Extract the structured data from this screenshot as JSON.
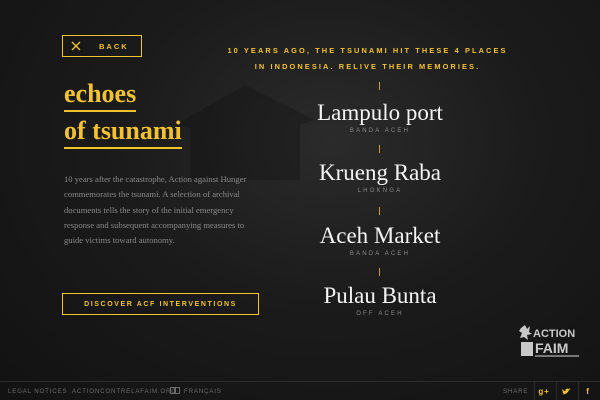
{
  "nav": {
    "back_label": "BACK"
  },
  "title": {
    "line1": "echoes",
    "line2": "of tsunami"
  },
  "description": "10 years after the catastrophe, Action against Hunger commemorates the tsunami. A selection of archival documents tells the story of the initial emergency response and subsequent accompanying measures to guide victims toward autonomy.",
  "discover_label": "DISCOVER ACF INTERVENTIONS",
  "intro": {
    "line1": "10 YEARS AGO, THE TSUNAMI HIT THESE 4 PLACES",
    "line2": "IN INDONESIA. RELIVE THEIR MEMORIES."
  },
  "places": [
    {
      "name": "Lampulo port",
      "sub": "BANDA ACEH"
    },
    {
      "name": "Krueng Raba",
      "sub": "LHOKNGA"
    },
    {
      "name": "Aceh Market",
      "sub": "BANDA ACEH"
    },
    {
      "name": "Pulau Bunta",
      "sub": "OFF ACEH"
    }
  ],
  "logo": {
    "line1": "ACTION",
    "line2": "FAIM"
  },
  "footer": {
    "legal": "LEGAL NOTICES",
    "site": "ACTIONCONTRELAFAIM.ORG",
    "lang": "FRANÇAIS",
    "share": "SHARE"
  },
  "icons": {
    "back": "close-icon",
    "googleplus": "googleplus-icon",
    "twitter": "twitter-icon",
    "facebook": "facebook-icon",
    "flag": "flag-icon"
  },
  "colors": {
    "accent": "#f2c230",
    "background": "#1b1b1b",
    "text": "#f4f4f4",
    "muted": "#8a8a8a"
  }
}
